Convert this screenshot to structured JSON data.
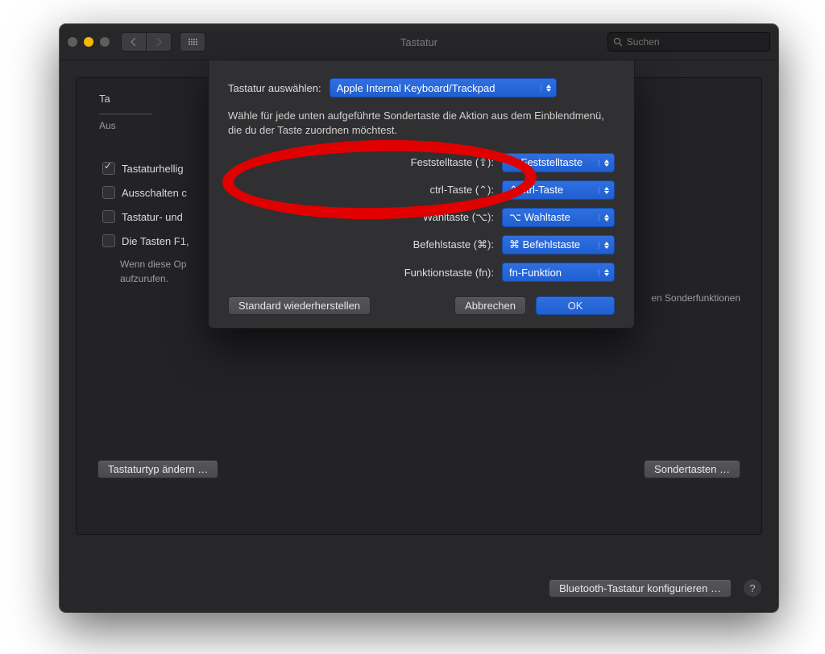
{
  "window": {
    "title": "Tastatur"
  },
  "search": {
    "placeholder": "Suchen"
  },
  "tabs": {
    "stub": "Ta",
    "sub": "Aus"
  },
  "checks": [
    {
      "checked": true,
      "label": "Tastaturhellig"
    },
    {
      "checked": false,
      "label": "Ausschalten c"
    },
    {
      "checked": false,
      "label": "Tastatur- und"
    },
    {
      "checked": false,
      "label": "Die Tasten F1,"
    }
  ],
  "checks_sub1": "Wenn diese Op",
  "checks_sub2": "aufzurufen.",
  "right_note": "en Sonderfunktionen",
  "buttons": {
    "change_type": "Tastaturtyp ändern …",
    "modifier": "Sondertasten …",
    "bluetooth": "Bluetooth-Tastatur konfigurieren …"
  },
  "sheet": {
    "select_kb_label": "Tastatur auswählen:",
    "select_kb_value": "Apple Internal Keyboard/Trackpad",
    "desc": "Wähle für jede unten aufgeführte Sondertaste die Aktion aus dem Einblendmenü, die du der Taste zuordnen möchtest.",
    "rows": [
      {
        "label": "Feststelltaste (⇪):",
        "value": "⇪ Feststelltaste"
      },
      {
        "label": "ctrl-Taste (⌃):",
        "value": "⌃ ctrl-Taste"
      },
      {
        "label": "Wahltaste (⌥):",
        "value": "⌥ Wahltaste"
      },
      {
        "label": "Befehlstaste (⌘):",
        "value": "⌘ Befehlstaste"
      },
      {
        "label": "Funktionstaste (fn):",
        "value": "fn-Funktion"
      }
    ],
    "restore": "Standard wiederherstellen",
    "cancel": "Abbrechen",
    "ok": "OK"
  }
}
